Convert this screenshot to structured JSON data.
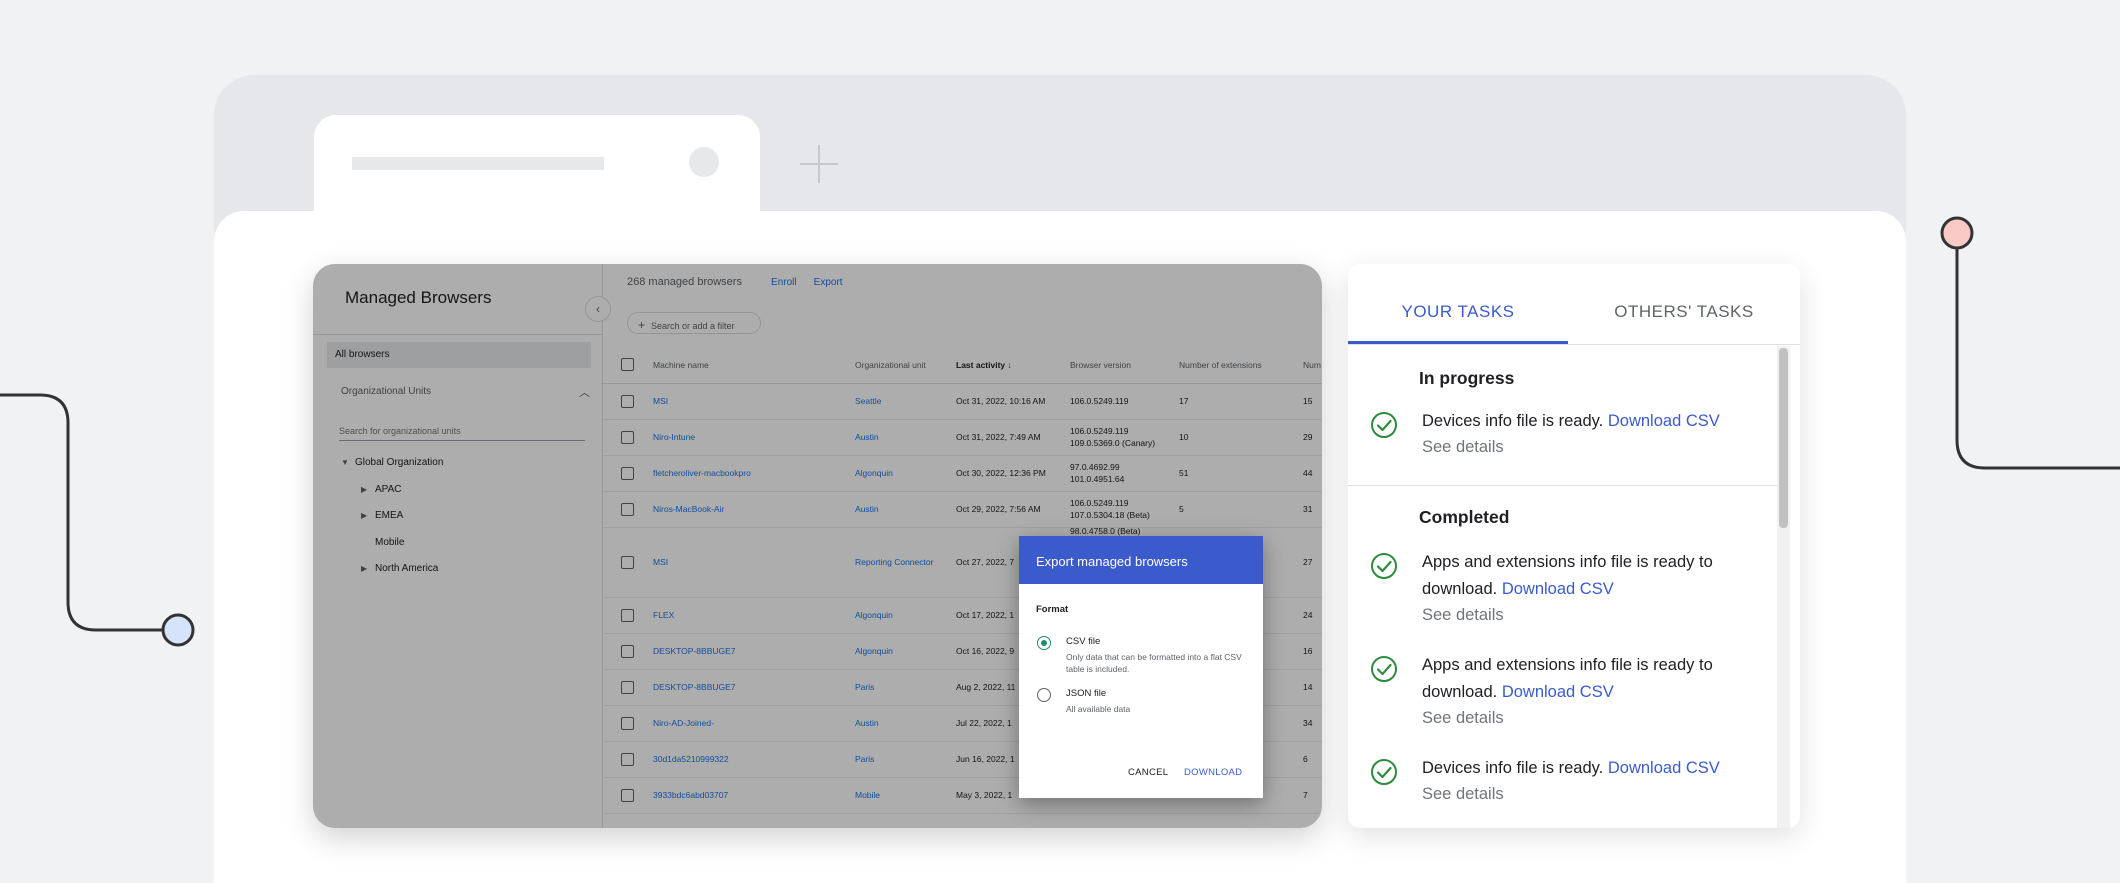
{
  "console": {
    "title": "Managed Browsers",
    "sidebar": {
      "all_browsers": "All browsers",
      "org_units_label": "Organizational Units",
      "search_placeholder": "Search for organizational units",
      "tree": [
        {
          "label": "Global Organization",
          "level": 0,
          "arrow": "down"
        },
        {
          "label": "APAC",
          "level": 1,
          "arrow": "right"
        },
        {
          "label": "EMEA",
          "level": 1,
          "arrow": "right"
        },
        {
          "label": "Mobile",
          "level": 1,
          "arrow": "none"
        },
        {
          "label": "North America",
          "level": 1,
          "arrow": "right"
        }
      ]
    },
    "count_text": "268 managed browsers",
    "enroll_label": "Enroll",
    "export_label": "Export",
    "filter_placeholder": "Search or add a filter",
    "columns": [
      "Machine name",
      "Organizational unit",
      "Last activity",
      "Browser version",
      "Number of extensions",
      "Num"
    ],
    "rows": [
      {
        "name": "MSI",
        "ou": "Seattle",
        "activity": "Oct 31, 2022, 10:16 AM",
        "version": [
          "106.0.5249.119"
        ],
        "ext": "17",
        "num": "15"
      },
      {
        "name": "Niro-Intune",
        "ou": "Austin",
        "activity": "Oct 31, 2022, 7:49 AM",
        "version": [
          "106.0.5249.119",
          "109.0.5369.0 (Canary)"
        ],
        "ext": "10",
        "num": "29"
      },
      {
        "name": "fletcheroliver-macbookpro",
        "ou": "Algonquin",
        "activity": "Oct 30, 2022, 12:36 PM",
        "version": [
          "97.0.4692.99",
          "101.0.4951.64"
        ],
        "ext": "51",
        "num": "44"
      },
      {
        "name": "Niros-MacBook-Air",
        "ou": "Austin",
        "activity": "Oct 29, 2022, 7:56 AM",
        "version": [
          "106.0.5249.119",
          "107.0.5304.18 (Beta)"
        ],
        "ext": "5",
        "num": "31"
      },
      {
        "name": "MSI",
        "ou": "Reporting Connector",
        "activity": "Oct 27, 2022, 7",
        "version": [
          "98.0.4758.0 (Beta)"
        ],
        "ext": "",
        "num": "27"
      },
      {
        "name": "FLEX",
        "ou": "Algonquin",
        "activity": "Oct 17, 2022, 1",
        "version": [],
        "ext": "",
        "num": "24"
      },
      {
        "name": "DESKTOP-8BBUGE7",
        "ou": "Algonquin",
        "activity": "Oct 16, 2022, 9",
        "version": [],
        "ext": "",
        "num": "16"
      },
      {
        "name": "DESKTOP-8BBUGE7",
        "ou": "Paris",
        "activity": "Aug 2, 2022, 11",
        "version": [],
        "ext": "",
        "num": "14"
      },
      {
        "name": "Niro-AD-Joined-",
        "ou": "Austin",
        "activity": "Jul 22, 2022, 1",
        "version": [],
        "ext": "",
        "num": "34"
      },
      {
        "name": "30d1da5210999322",
        "ou": "Paris",
        "activity": "Jun 16, 2022, 1",
        "version": [],
        "ext": "",
        "num": "6"
      },
      {
        "name": "3933bdc6abd03707",
        "ou": "Mobile",
        "activity": "May 3, 2022, 1",
        "version": [],
        "ext": "",
        "num": "7"
      }
    ]
  },
  "dialog": {
    "title": "Export managed browsers",
    "format_label": "Format",
    "options": [
      {
        "title": "CSV file",
        "desc": "Only data that can be formatted into a flat CSV table is included.",
        "selected": true
      },
      {
        "title": "JSON file",
        "desc": "All available data",
        "selected": false
      }
    ],
    "cancel_label": "CANCEL",
    "download_label": "DOWNLOAD"
  },
  "tasks": {
    "tab_yours": "YOUR TASKS",
    "tab_others": "OTHERS' TASKS",
    "in_progress_title": "In progress",
    "completed_title": "Completed",
    "in_progress": [
      {
        "text": "Devices info file is ready.",
        "link": "Download CSV",
        "details": "See details"
      }
    ],
    "completed": [
      {
        "text": "Apps and extensions info file is ready to download.",
        "link": "Download CSV",
        "details": "See details"
      },
      {
        "text": "Apps and extensions info file is ready to download.",
        "link": "Download CSV",
        "details": "See details"
      },
      {
        "text": "Devices info file is ready.",
        "link": "Download CSV",
        "details": "See details"
      }
    ]
  },
  "colors": {
    "accent": "#3b5bcc",
    "success": "#2e8b3d",
    "deco_red": "#f9c9c5",
    "deco_blue": "#d6e4fb"
  }
}
